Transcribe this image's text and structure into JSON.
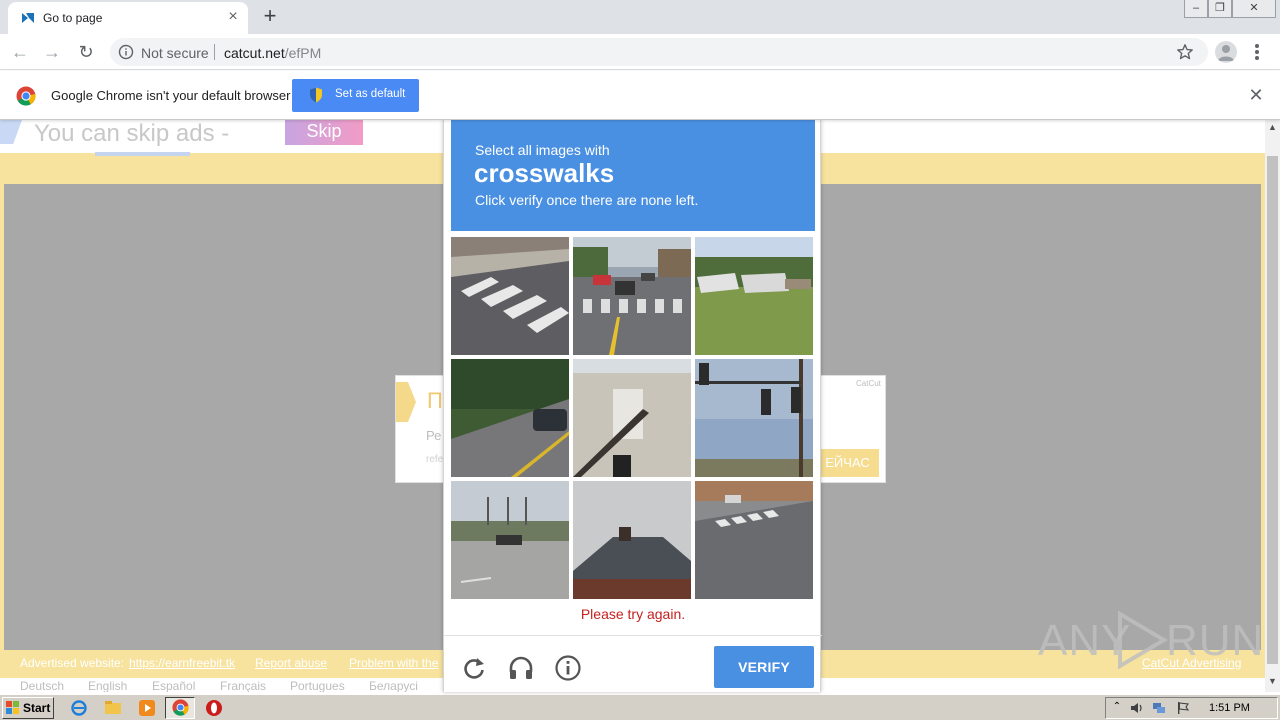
{
  "browser": {
    "tab_title": "Go to page",
    "tab_close": "×",
    "new_tab": "+",
    "window_controls": {
      "minimize": "‒",
      "restore": "❐",
      "close": "✕"
    },
    "nav": {
      "back": "←",
      "forward": "→",
      "reload": "↻"
    },
    "address": {
      "security": "Not secure",
      "domain": "catcut.net",
      "path": "/efPM"
    },
    "infobar": {
      "message": "Google Chrome isn't your default browser",
      "button": "Set as default",
      "close": "✕"
    }
  },
  "page": {
    "skip": {
      "text": "You can skip ads  -",
      "button": "Skip"
    },
    "ad_card": {
      "title": "П",
      "line1": "Ре",
      "line2": "refe",
      "brand": "CatCut",
      "button": "ЕЙЧАС"
    },
    "footer_links": [
      {
        "label": "Advertised website:",
        "underline": false
      },
      {
        "label": "https://earnfreebit.tk",
        "underline": true
      },
      {
        "label": "Report abuse",
        "underline": true
      },
      {
        "label": "Problem with the",
        "underline": true
      },
      {
        "label": "CatCut Advertising",
        "underline": true
      }
    ],
    "languages": [
      "Deutsch",
      "English",
      "Español",
      "Français",
      "Portugues",
      "Беларусі"
    ]
  },
  "captcha": {
    "instruction": "Select all images with",
    "target": "crosswalks",
    "hint": "Click verify once there are none left.",
    "error": "Please try again.",
    "verify_button": "VERIFY",
    "header_color": "#4a90e2",
    "tiles": [
      "crosswalk-closeup",
      "street-with-cars",
      "boats-on-grass",
      "road-with-car",
      "building-stairs",
      "traffic-lights",
      "intersection-road",
      "house-roof",
      "road-crosswalk"
    ],
    "footer_icons": [
      "reload-icon",
      "headphones-icon",
      "info-icon"
    ]
  },
  "watermark": {
    "left": "ANY",
    "right": "RUN"
  },
  "taskbar": {
    "start": "Start",
    "apps": [
      "ie-icon",
      "explorer-icon",
      "media-player-icon",
      "chrome-icon",
      "opera-icon"
    ],
    "clock": "1:51 PM"
  }
}
